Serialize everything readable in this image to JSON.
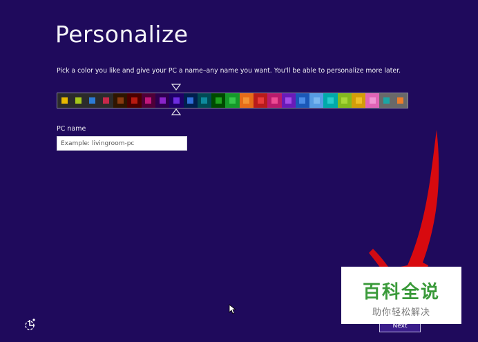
{
  "page": {
    "title": "Personalize",
    "subtitle": "Pick a color you like and give your PC a name–any name you want. You'll be able to personalize more later."
  },
  "color_picker": {
    "selected_index": 8,
    "swatches": [
      {
        "bg": "#2b2b2b",
        "fg": "#e8b900"
      },
      {
        "bg": "#2b2b2b",
        "fg": "#a6c81b"
      },
      {
        "bg": "#2b2b2b",
        "fg": "#2c7bd6"
      },
      {
        "bg": "#2b2b2b",
        "fg": "#c8284b"
      },
      {
        "bg": "#2e1500",
        "fg": "#8a3a10"
      },
      {
        "bg": "#4a0000",
        "fg": "#b81a10"
      },
      {
        "bg": "#4e0038",
        "fg": "#c2177c"
      },
      {
        "bg": "#2d004e",
        "fg": "#8a24c9"
      },
      {
        "bg": "#1f0068",
        "fg": "#6d2ce0"
      },
      {
        "bg": "#001e4e",
        "fg": "#2f6ed8"
      },
      {
        "bg": "#004a54",
        "fg": "#0e8a9d"
      },
      {
        "bg": "#004a00",
        "fg": "#1ea21e"
      },
      {
        "bg": "#15992a",
        "fg": "#37c84c"
      },
      {
        "bg": "#e56c19",
        "fg": "#f49434"
      },
      {
        "bg": "#b81b1b",
        "fg": "#ea3a3a"
      },
      {
        "bg": "#b81b6c",
        "fg": "#ed4b94"
      },
      {
        "bg": "#691bb8",
        "fg": "#a54be8"
      },
      {
        "bg": "#1b58b8",
        "fg": "#4a8ce8"
      },
      {
        "bg": "#569ce3",
        "fg": "#7ab8f0"
      },
      {
        "bg": "#00aaaa",
        "fg": "#28cccc"
      },
      {
        "bg": "#83ba1f",
        "fg": "#a8d838"
      },
      {
        "bg": "#d39d09",
        "fg": "#efbf26"
      },
      {
        "bg": "#e064b7",
        "fg": "#f094d4"
      },
      {
        "bg": "#696969",
        "fg": "#1aa6a6"
      },
      {
        "bg": "#696969",
        "fg": "#ee7d2a"
      }
    ]
  },
  "pc_name": {
    "label": "PC name",
    "placeholder": "Example: livingroom-pc",
    "value": ""
  },
  "footer": {
    "next_label": "Next"
  },
  "overlay": {
    "watermark_main": "百科全说",
    "watermark_sub": "助你轻松解决"
  },
  "colors": {
    "background": "#1f0a5c",
    "annotation_arrow": "#e30b0b",
    "watermark_green": "#3a9a3a"
  },
  "icons": {
    "accessibility": "ease-of-access-icon",
    "cursor": "mouse-pointer-icon",
    "picker_indicator": "chevron-indicator-icon"
  }
}
